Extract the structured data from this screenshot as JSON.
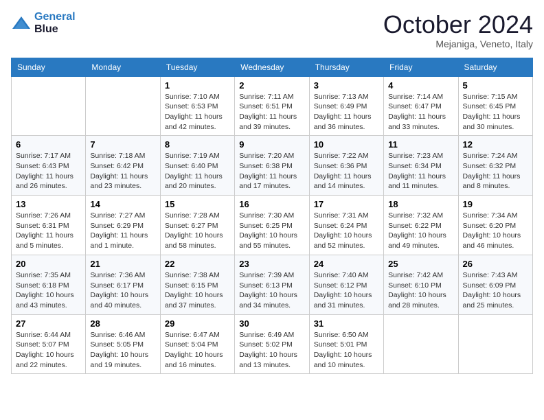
{
  "header": {
    "logo_line1": "General",
    "logo_line2": "Blue",
    "month_title": "October 2024",
    "location": "Mejaniga, Veneto, Italy"
  },
  "days_of_week": [
    "Sunday",
    "Monday",
    "Tuesday",
    "Wednesday",
    "Thursday",
    "Friday",
    "Saturday"
  ],
  "weeks": [
    [
      {
        "day": "",
        "sunrise": "",
        "sunset": "",
        "daylight": ""
      },
      {
        "day": "",
        "sunrise": "",
        "sunset": "",
        "daylight": ""
      },
      {
        "day": "1",
        "sunrise": "Sunrise: 7:10 AM",
        "sunset": "Sunset: 6:53 PM",
        "daylight": "Daylight: 11 hours and 42 minutes."
      },
      {
        "day": "2",
        "sunrise": "Sunrise: 7:11 AM",
        "sunset": "Sunset: 6:51 PM",
        "daylight": "Daylight: 11 hours and 39 minutes."
      },
      {
        "day": "3",
        "sunrise": "Sunrise: 7:13 AM",
        "sunset": "Sunset: 6:49 PM",
        "daylight": "Daylight: 11 hours and 36 minutes."
      },
      {
        "day": "4",
        "sunrise": "Sunrise: 7:14 AM",
        "sunset": "Sunset: 6:47 PM",
        "daylight": "Daylight: 11 hours and 33 minutes."
      },
      {
        "day": "5",
        "sunrise": "Sunrise: 7:15 AM",
        "sunset": "Sunset: 6:45 PM",
        "daylight": "Daylight: 11 hours and 30 minutes."
      }
    ],
    [
      {
        "day": "6",
        "sunrise": "Sunrise: 7:17 AM",
        "sunset": "Sunset: 6:43 PM",
        "daylight": "Daylight: 11 hours and 26 minutes."
      },
      {
        "day": "7",
        "sunrise": "Sunrise: 7:18 AM",
        "sunset": "Sunset: 6:42 PM",
        "daylight": "Daylight: 11 hours and 23 minutes."
      },
      {
        "day": "8",
        "sunrise": "Sunrise: 7:19 AM",
        "sunset": "Sunset: 6:40 PM",
        "daylight": "Daylight: 11 hours and 20 minutes."
      },
      {
        "day": "9",
        "sunrise": "Sunrise: 7:20 AM",
        "sunset": "Sunset: 6:38 PM",
        "daylight": "Daylight: 11 hours and 17 minutes."
      },
      {
        "day": "10",
        "sunrise": "Sunrise: 7:22 AM",
        "sunset": "Sunset: 6:36 PM",
        "daylight": "Daylight: 11 hours and 14 minutes."
      },
      {
        "day": "11",
        "sunrise": "Sunrise: 7:23 AM",
        "sunset": "Sunset: 6:34 PM",
        "daylight": "Daylight: 11 hours and 11 minutes."
      },
      {
        "day": "12",
        "sunrise": "Sunrise: 7:24 AM",
        "sunset": "Sunset: 6:32 PM",
        "daylight": "Daylight: 11 hours and 8 minutes."
      }
    ],
    [
      {
        "day": "13",
        "sunrise": "Sunrise: 7:26 AM",
        "sunset": "Sunset: 6:31 PM",
        "daylight": "Daylight: 11 hours and 5 minutes."
      },
      {
        "day": "14",
        "sunrise": "Sunrise: 7:27 AM",
        "sunset": "Sunset: 6:29 PM",
        "daylight": "Daylight: 11 hours and 1 minute."
      },
      {
        "day": "15",
        "sunrise": "Sunrise: 7:28 AM",
        "sunset": "Sunset: 6:27 PM",
        "daylight": "Daylight: 10 hours and 58 minutes."
      },
      {
        "day": "16",
        "sunrise": "Sunrise: 7:30 AM",
        "sunset": "Sunset: 6:25 PM",
        "daylight": "Daylight: 10 hours and 55 minutes."
      },
      {
        "day": "17",
        "sunrise": "Sunrise: 7:31 AM",
        "sunset": "Sunset: 6:24 PM",
        "daylight": "Daylight: 10 hours and 52 minutes."
      },
      {
        "day": "18",
        "sunrise": "Sunrise: 7:32 AM",
        "sunset": "Sunset: 6:22 PM",
        "daylight": "Daylight: 10 hours and 49 minutes."
      },
      {
        "day": "19",
        "sunrise": "Sunrise: 7:34 AM",
        "sunset": "Sunset: 6:20 PM",
        "daylight": "Daylight: 10 hours and 46 minutes."
      }
    ],
    [
      {
        "day": "20",
        "sunrise": "Sunrise: 7:35 AM",
        "sunset": "Sunset: 6:18 PM",
        "daylight": "Daylight: 10 hours and 43 minutes."
      },
      {
        "day": "21",
        "sunrise": "Sunrise: 7:36 AM",
        "sunset": "Sunset: 6:17 PM",
        "daylight": "Daylight: 10 hours and 40 minutes."
      },
      {
        "day": "22",
        "sunrise": "Sunrise: 7:38 AM",
        "sunset": "Sunset: 6:15 PM",
        "daylight": "Daylight: 10 hours and 37 minutes."
      },
      {
        "day": "23",
        "sunrise": "Sunrise: 7:39 AM",
        "sunset": "Sunset: 6:13 PM",
        "daylight": "Daylight: 10 hours and 34 minutes."
      },
      {
        "day": "24",
        "sunrise": "Sunrise: 7:40 AM",
        "sunset": "Sunset: 6:12 PM",
        "daylight": "Daylight: 10 hours and 31 minutes."
      },
      {
        "day": "25",
        "sunrise": "Sunrise: 7:42 AM",
        "sunset": "Sunset: 6:10 PM",
        "daylight": "Daylight: 10 hours and 28 minutes."
      },
      {
        "day": "26",
        "sunrise": "Sunrise: 7:43 AM",
        "sunset": "Sunset: 6:09 PM",
        "daylight": "Daylight: 10 hours and 25 minutes."
      }
    ],
    [
      {
        "day": "27",
        "sunrise": "Sunrise: 6:44 AM",
        "sunset": "Sunset: 5:07 PM",
        "daylight": "Daylight: 10 hours and 22 minutes."
      },
      {
        "day": "28",
        "sunrise": "Sunrise: 6:46 AM",
        "sunset": "Sunset: 5:05 PM",
        "daylight": "Daylight: 10 hours and 19 minutes."
      },
      {
        "day": "29",
        "sunrise": "Sunrise: 6:47 AM",
        "sunset": "Sunset: 5:04 PM",
        "daylight": "Daylight: 10 hours and 16 minutes."
      },
      {
        "day": "30",
        "sunrise": "Sunrise: 6:49 AM",
        "sunset": "Sunset: 5:02 PM",
        "daylight": "Daylight: 10 hours and 13 minutes."
      },
      {
        "day": "31",
        "sunrise": "Sunrise: 6:50 AM",
        "sunset": "Sunset: 5:01 PM",
        "daylight": "Daylight: 10 hours and 10 minutes."
      },
      {
        "day": "",
        "sunrise": "",
        "sunset": "",
        "daylight": ""
      },
      {
        "day": "",
        "sunrise": "",
        "sunset": "",
        "daylight": ""
      }
    ]
  ]
}
